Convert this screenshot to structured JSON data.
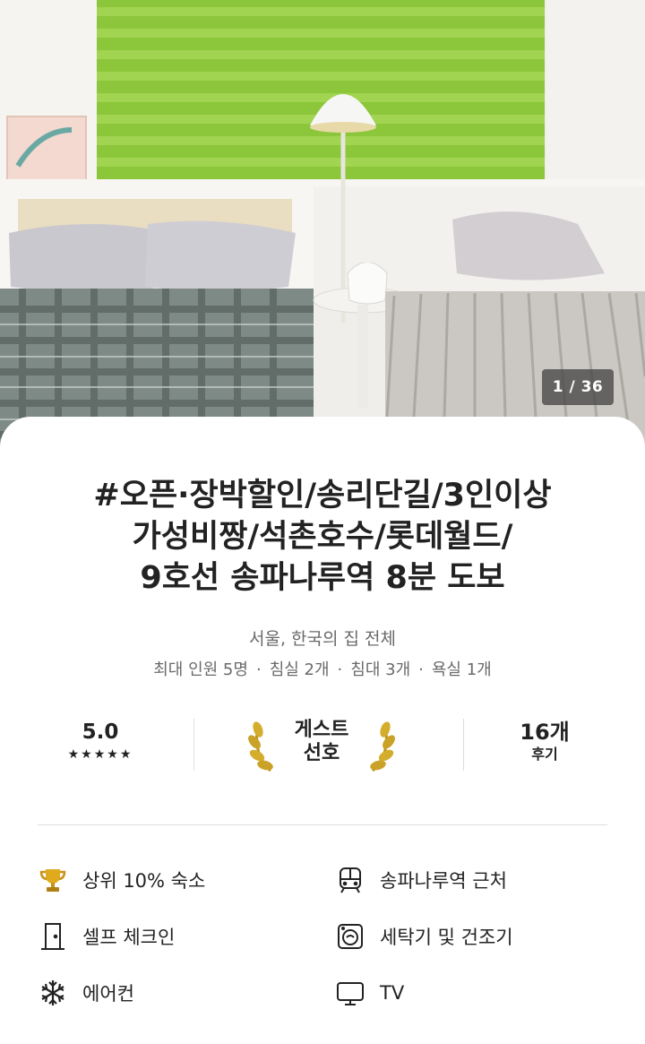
{
  "gallery": {
    "counter": "1 / 36"
  },
  "listing": {
    "title_lines": [
      "#오픈·장박할인/송리단길/3인이상",
      "가성비짱/석촌호수/롯데월드/",
      "9호선 송파나루역 8분 도보"
    ],
    "subtitle": "서울, 한국의 집 전체",
    "details": [
      "최대 인원 5명",
      "침실 2개",
      "침대 3개",
      "욕실 1개"
    ],
    "separator": "·"
  },
  "stats": {
    "rating": "5.0",
    "stars": "★★★★★",
    "guest_favorite": [
      "게스트",
      "선호"
    ],
    "reviews_count": "16개",
    "reviews_label": "후기"
  },
  "amenities": [
    {
      "label": "상위 10% 숙소",
      "icon": "trophy-icon"
    },
    {
      "label": "송파나루역 근처",
      "icon": "train-icon"
    },
    {
      "label": "셀프 체크인",
      "icon": "door-icon"
    },
    {
      "label": "세탁기 및 건조기",
      "icon": "washer-icon"
    },
    {
      "label": "에어컨",
      "icon": "snowflake-icon"
    },
    {
      "label": "TV",
      "icon": "tv-icon"
    }
  ],
  "colors": {
    "trophy": "#d9a21b",
    "laurel": "#c9a227",
    "text": "#222222",
    "muted": "#6a6a6a"
  }
}
